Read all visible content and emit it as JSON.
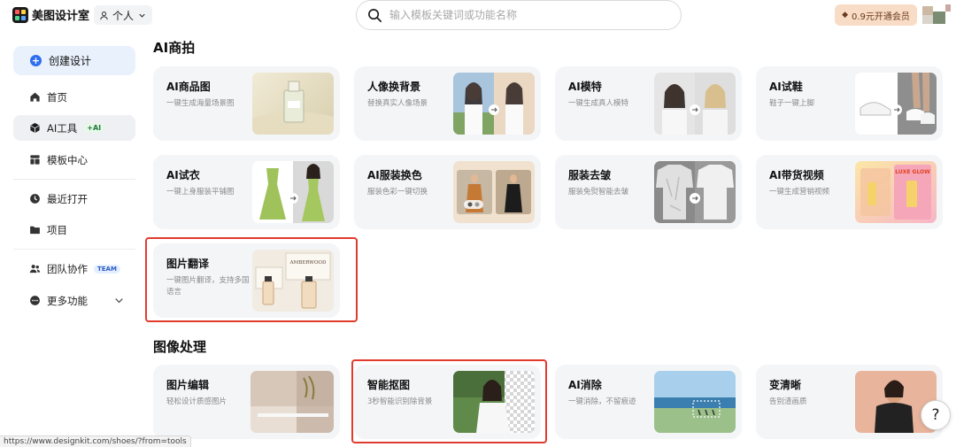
{
  "app": {
    "name": "美图设计室"
  },
  "workspace": {
    "label": "个人"
  },
  "search": {
    "placeholder": "输入模板关键词或功能名称"
  },
  "vip": {
    "label": "0.9元开通会员"
  },
  "sidebar": {
    "create_label": "创建设计",
    "items": [
      {
        "label": "首页"
      },
      {
        "label": "AI工具",
        "badge": "+AI"
      },
      {
        "label": "模板中心"
      },
      {
        "label": "最近打开"
      },
      {
        "label": "项目"
      },
      {
        "label": "团队协作",
        "badge": "TEAM"
      },
      {
        "label": "更多功能"
      }
    ]
  },
  "sections": [
    {
      "title": "AI商拍",
      "cards": [
        {
          "title": "AI商品图",
          "desc": "一键生成海量场景图"
        },
        {
          "title": "人像换背景",
          "desc": "替换真实人像场景"
        },
        {
          "title": "AI模特",
          "desc": "一键生成真人模特"
        },
        {
          "title": "AI试鞋",
          "desc": "鞋子一键上脚"
        },
        {
          "title": "AI试衣",
          "desc": "一键上身服装平铺图"
        },
        {
          "title": "AI服装换色",
          "desc": "服装色彩一键切换"
        },
        {
          "title": "服装去皱",
          "desc": "服装免熨智能去皱"
        },
        {
          "title": "AI带货视频",
          "desc": "一键生成营销视频"
        },
        {
          "title": "图片翻译",
          "desc": "一键图片翻译，支持多国语言"
        }
      ]
    },
    {
      "title": "图像处理",
      "cards": [
        {
          "title": "图片编辑",
          "desc": "轻松设计质感图片"
        },
        {
          "title": "智能抠图",
          "desc": "3秒智能识别除背景"
        },
        {
          "title": "AI消除",
          "desc": "一键消除，不留痕迹"
        },
        {
          "title": "变清晰",
          "desc": "告别渣画质"
        }
      ]
    }
  ],
  "thumb_text": {
    "perfume_brand": "AMBERWOOD",
    "video_promo": "LUXE GLOW"
  },
  "status_url": "https://www.designkit.com/shoes/?from=tools",
  "help_label": "?",
  "colors": {
    "accent": "#2e6ff0",
    "highlight": "#e23b2e",
    "card_bg": "#f4f5f7"
  }
}
